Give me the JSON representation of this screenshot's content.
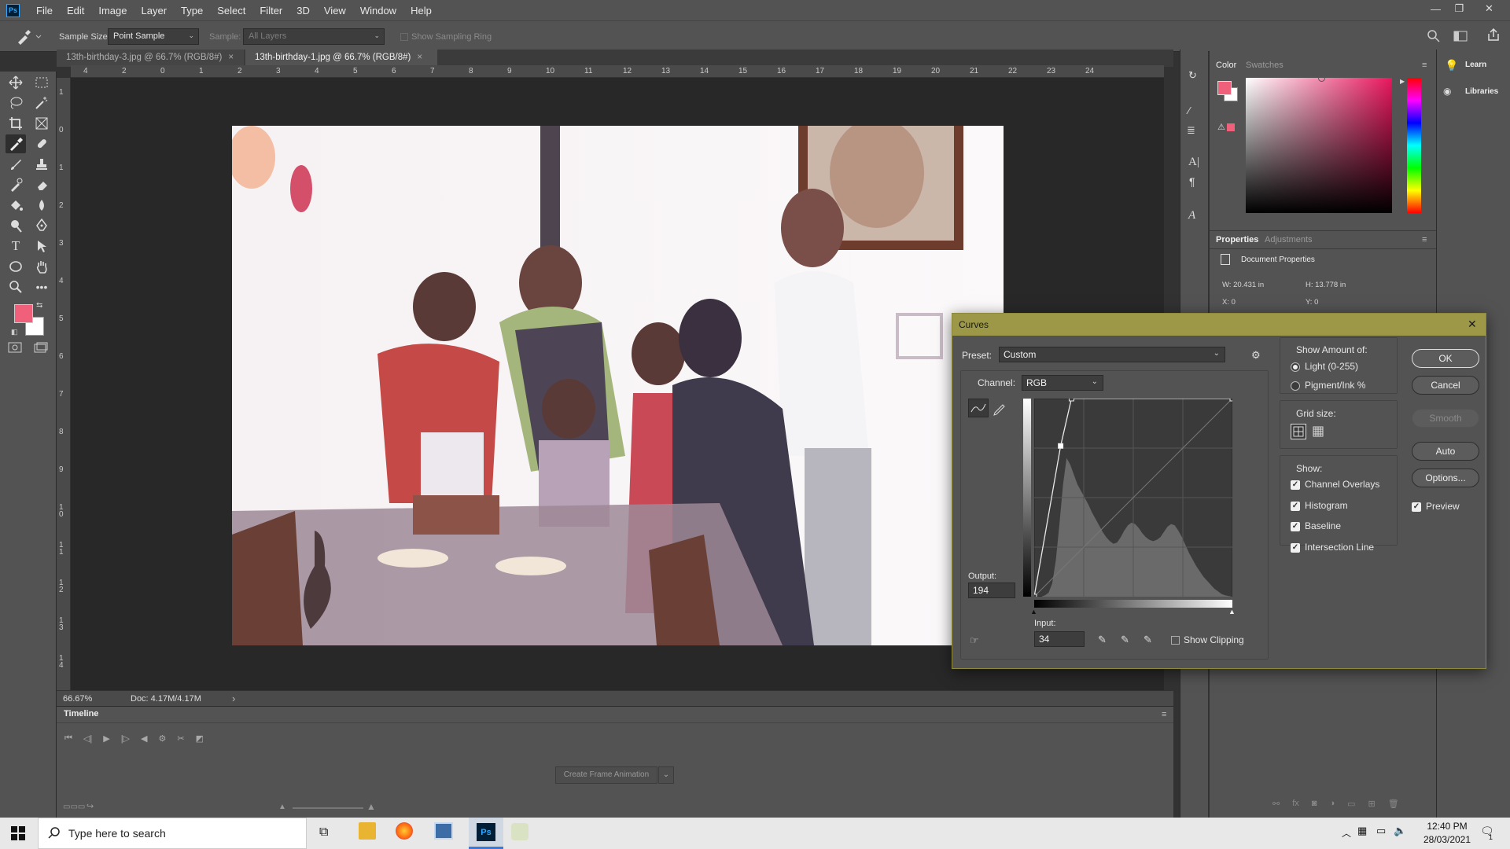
{
  "app": {
    "logo": "Ps"
  },
  "menu": [
    "File",
    "Edit",
    "Image",
    "Layer",
    "Type",
    "Select",
    "Filter",
    "3D",
    "View",
    "Window",
    "Help"
  ],
  "options": {
    "sample_size_label": "Sample Size:",
    "sample_size_value": "Point Sample",
    "sample_label": "Sample:",
    "sample_value": "All Layers",
    "show_ring_label": "Show Sampling Ring"
  },
  "tabs": [
    {
      "label": "13th-birthday-3.jpg @ 66.7% (RGB/8#)",
      "close": "×"
    },
    {
      "label": "13th-birthday-1.jpg @ 66.7% (RGB/8#)",
      "close": "×"
    }
  ],
  "ruler": {
    "h": [
      "4",
      "2",
      "0",
      "1",
      "2",
      "3",
      "4",
      "5",
      "6",
      "7",
      "8",
      "9",
      "10",
      "11",
      "12",
      "13",
      "14",
      "15",
      "16",
      "17",
      "18",
      "19",
      "20",
      "21",
      "22",
      "23",
      "24"
    ],
    "v": [
      "1",
      "0",
      "1",
      "2",
      "3",
      "4",
      "5",
      "6",
      "7",
      "8",
      "9",
      "1 0",
      "1 1",
      "1 2",
      "1 3",
      "1 4"
    ]
  },
  "status": {
    "zoom": "66.67%",
    "doc": "Doc: 4.17M/4.17M",
    "arrow": "›"
  },
  "timeline": {
    "title": "Timeline",
    "create_button": "Create Frame Animation"
  },
  "color_panel": {
    "tab_color": "Color",
    "tab_swatches": "Swatches",
    "fg": "#f0607a",
    "bg": "#ffffff",
    "gradient_hue": "#e8175d"
  },
  "properties_panel": {
    "tab_properties": "Properties",
    "tab_adjustments": "Adjustments",
    "doc_props": "Document Properties",
    "w": "W:  20.431 in",
    "h": "H:  13.778 in",
    "x": "X:  0",
    "y": "Y:  0"
  },
  "right_dock": {
    "learn": "Learn",
    "libraries": "Libraries"
  },
  "curves": {
    "title": "Curves",
    "close": "✕",
    "preset_label": "Preset:",
    "preset_value": "Custom",
    "channel_label": "Channel:",
    "channel_value": "RGB",
    "output_label": "Output:",
    "output_value": "194",
    "input_label": "Input:",
    "input_value": "34",
    "show_clipping": "Show Clipping",
    "show_amount_title": "Show Amount of:",
    "light_option": "Light  (0-255)",
    "pigment_option": "Pigment/Ink %",
    "grid_size_title": "Grid size:",
    "show_title": "Show:",
    "show_items": [
      "Channel Overlays",
      "Histogram",
      "Baseline",
      "Intersection Line"
    ],
    "buttons": {
      "ok": "OK",
      "cancel": "Cancel",
      "smooth": "Smooth",
      "auto": "Auto",
      "options": "Options..."
    },
    "preview": "Preview",
    "curve_points": [
      [
        0,
        0
      ],
      [
        34,
        194
      ],
      [
        48,
        255
      ],
      [
        255,
        255
      ]
    ],
    "histogram": [
      0,
      0,
      0,
      2,
      6,
      20,
      55,
      110,
      170,
      210,
      200,
      185,
      170,
      160,
      150,
      140,
      128,
      118,
      108,
      98,
      90,
      84,
      80,
      82,
      90,
      100,
      108,
      112,
      110,
      104,
      96,
      90,
      86,
      84,
      86,
      90,
      98,
      106,
      110,
      108,
      100,
      90,
      78,
      66,
      56,
      46,
      38,
      30,
      24,
      18,
      12,
      8,
      4,
      2,
      1,
      0
    ]
  },
  "taskbar": {
    "search_placeholder": "Type here to search",
    "time": "12:40 PM",
    "date": "28/03/2021",
    "notif_count": "1"
  }
}
